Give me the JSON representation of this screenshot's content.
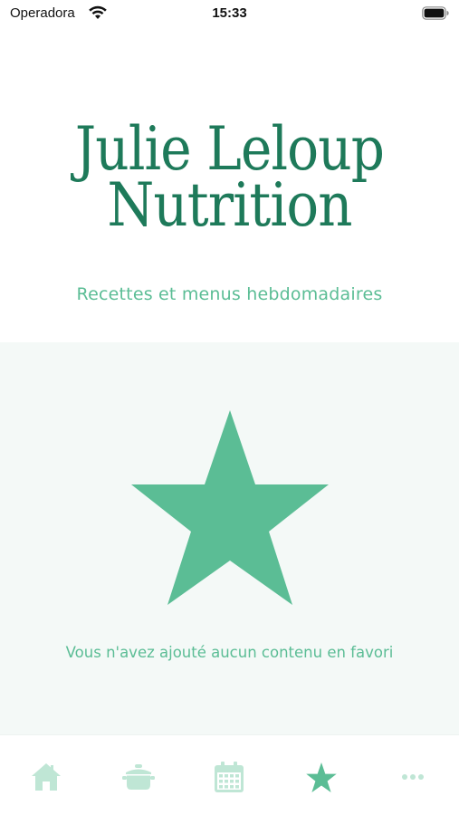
{
  "status_bar": {
    "carrier": "Operadora",
    "time": "15:33"
  },
  "brand": {
    "line1": "Julie Leloup",
    "line2": "Nutrition"
  },
  "tagline": "Recettes et menus hebdomadaires",
  "favorites": {
    "empty_message": "Vous n'avez ajouté aucun contenu en favori",
    "icon": "star-icon"
  },
  "tabbar": {
    "tabs": [
      {
        "icon": "home-icon",
        "active": false
      },
      {
        "icon": "cooking-pot-icon",
        "active": false
      },
      {
        "icon": "calendar-icon",
        "active": false
      },
      {
        "icon": "star-icon",
        "active": true
      },
      {
        "icon": "more-dots-icon",
        "active": false
      }
    ]
  },
  "colors": {
    "brand": "#1e7a5a",
    "accent": "#5bbd95",
    "inactive": "#bfe6d5",
    "section_bg": "#f4f9f7"
  }
}
